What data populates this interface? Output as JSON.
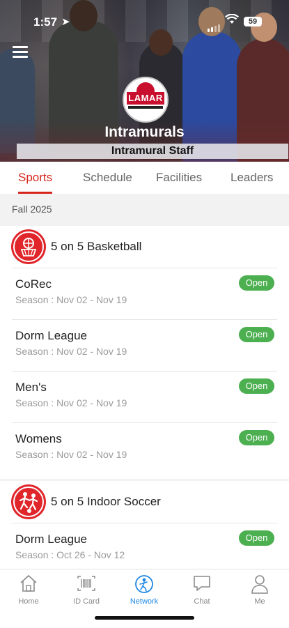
{
  "status_bar": {
    "time": "1:57",
    "battery": "59"
  },
  "header": {
    "title": "Intramurals",
    "subtitle": "Intramural Staff",
    "logo_text": "LAMAR"
  },
  "tabs": [
    {
      "label": "Sports",
      "active": true
    },
    {
      "label": "Schedule",
      "active": false
    },
    {
      "label": "Facilities",
      "active": false
    },
    {
      "label": "Leaders",
      "active": false
    }
  ],
  "season_label": "Fall 2025",
  "sports": [
    {
      "name": "5 on 5 Basketball",
      "icon": "basketball-icon",
      "leagues": [
        {
          "name": "CoRec",
          "season": "Season : Nov 02 - Nov 19",
          "status": "Open"
        },
        {
          "name": "Dorm League",
          "season": "Season : Nov 02 - Nov 19",
          "status": "Open"
        },
        {
          "name": "Men's",
          "season": "Season : Nov 02 - Nov 19",
          "status": "Open"
        },
        {
          "name": "Womens",
          "season": "Season : Nov 02 - Nov 19",
          "status": "Open"
        }
      ]
    },
    {
      "name": "5 on 5 Indoor Soccer",
      "icon": "soccer-icon",
      "leagues": [
        {
          "name": "Dorm League",
          "season": "Season : Oct 26 - Nov 12",
          "status": "Open"
        }
      ]
    }
  ],
  "bottom_nav": [
    {
      "label": "Home",
      "icon": "home-icon",
      "active": false
    },
    {
      "label": "ID Card",
      "icon": "barcode-icon",
      "active": false
    },
    {
      "label": "Network",
      "icon": "network-icon",
      "active": true
    },
    {
      "label": "Chat",
      "icon": "chat-icon",
      "active": false
    },
    {
      "label": "Me",
      "icon": "person-icon",
      "active": false
    }
  ],
  "colors": {
    "accent": "#d7261d",
    "open_badge": "#4caf50",
    "nav_active": "#1e88e5"
  }
}
